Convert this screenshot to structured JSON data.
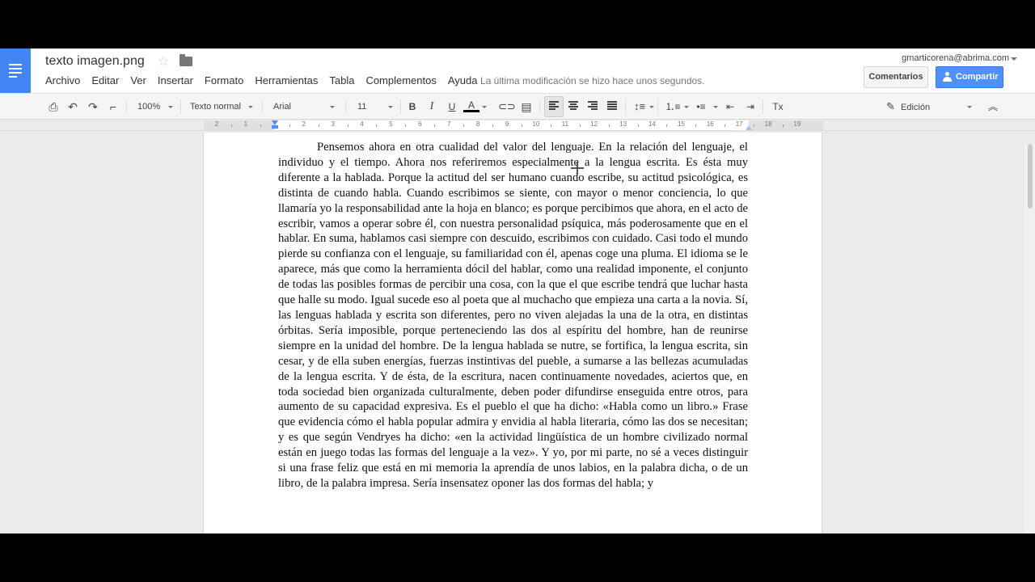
{
  "header": {
    "doc_title": "texto imagen.png",
    "menu": [
      "Archivo",
      "Editar",
      "Ver",
      "Insertar",
      "Formato",
      "Herramientas",
      "Tabla",
      "Complementos",
      "Ayuda"
    ],
    "last_edit": "La última modificación se hizo hace unos segundos.",
    "account": "gmarticorena@abrima.com",
    "comments_label": "Comentarios",
    "share_label": "Compartir",
    "accent_color": "#4285f4"
  },
  "toolbar": {
    "zoom": "100%",
    "style": "Texto normal",
    "font": "Arial",
    "size": "11",
    "bold": "B",
    "italic": "I",
    "underline": "U",
    "text_color": "A",
    "clear_format": "Tx",
    "mode": "Edición"
  },
  "ruler": {
    "labels": [
      "2",
      "1",
      "1",
      "2",
      "3",
      "4",
      "5",
      "6",
      "7",
      "8",
      "9",
      "10",
      "11",
      "12",
      "13",
      "14",
      "15",
      "16",
      "17",
      "18",
      "19"
    ]
  },
  "document": {
    "text": "Pensemos ahora en otra cualidad del valor del lenguaje. En la relación del lenguaje, el individuo y el tiempo. Ahora nos referiremos especialmente a la lengua escrita. Es ésta muy diferente a la hablada. Porque la actitud del ser humano cuando escribe, su actitud psicológica, es distinta de cuando habla. Cuando escribimos se siente, con mayor o menor conciencia, lo que llamaría yo la responsabilidad ante la hoja en blanco; es porque percibimos que ahora, en el acto de escribir, vamos a operar sobre él, con nuestra personalidad psíquica, más poderosamente que en el hablar. En suma, hablamos casi siempre con descuido, escribimos con cuidado. Casi todo el mundo pierde su confianza con el lenguaje, su familiaridad con él, apenas coge una pluma. El idioma se le aparece, más que como la herramienta dócil del hablar, como una realidad imponente, el conjunto de todas las posibles formas de percibir una cosa, con la que el que escribe tendrá que luchar hasta que halle su modo. Igual sucede eso al poeta que al muchacho que empieza una carta a la novia. Sí, las lenguas hablada y escrita son diferentes, pero no viven alejadas la una de la otra, en distintas órbitas. Sería imposible, porque perteneciendo las dos al espíritu del hombre, han de reunirse siempre en la unidad del hombre. De la lengua hablada se nutre, se fortifica, la lengua escrita, sin cesar, y de ella suben energías, fuerzas instintivas del pueble, a sumarse a las bellezas acumuladas de la lengua escrita. Y de ésta, de la escritura, nacen continuamente novedades, aciertos que, en toda sociedad bien organizada culturalmente, deben poder difundirse enseguida entre otros, para aumento de su capacidad expresiva. Es el pueblo el que ha dicho: «Habla como un libro.» Frase que evidencia cómo el habla popular admira y envidia al habla literaria, cómo las dos se necesitan; y es que según Vendryes ha dicho: «en la actividad lingüística de un hombre civilizado normal están en juego todas las formas del lenguaje a la vez». Y yo, por mi parte, no sé a veces distinguir si una frase feliz que está en mi memoria la aprendía de unos labios, en la palabra dicha, o de un libro, de la palabra impresa. Sería insensatez oponer las dos formas del habla; y"
  }
}
